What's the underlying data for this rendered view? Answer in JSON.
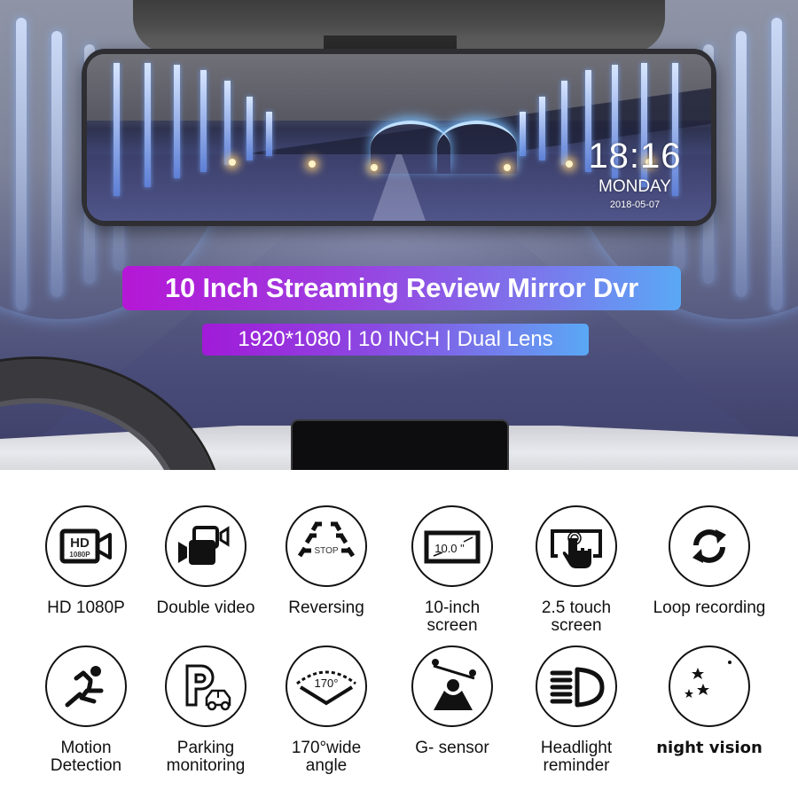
{
  "hero": {
    "mirror_display": {
      "time": "18:16",
      "day": "MONDAY",
      "date": "2018-05-07"
    },
    "title": "10 Inch Streaming Review Mirror Dvr",
    "subtitle": "1920*1080 | 10 INCH | Dual Lens",
    "colors": {
      "badge_gradient_start": "#b517d6",
      "badge_gradient_end": "#5aa8f5"
    }
  },
  "features": [
    {
      "icon": "hd-camera-icon",
      "label": "HD 1080P",
      "icon_text": [
        "HD",
        "1080P"
      ]
    },
    {
      "icon": "double-video-icon",
      "label": "Double video"
    },
    {
      "icon": "reversing-guide-icon",
      "label": "Reversing",
      "icon_text": [
        "STOP"
      ]
    },
    {
      "icon": "screen-size-icon",
      "label": "10-inch\nscreen",
      "icon_text": [
        "10.0 \""
      ]
    },
    {
      "icon": "touch-screen-icon",
      "label": "2.5 touch\nscreen"
    },
    {
      "icon": "loop-icon",
      "label": "Loop recording"
    },
    {
      "icon": "running-person-icon",
      "label": "Motion\nDetection"
    },
    {
      "icon": "parking-car-icon",
      "label": "Parking\nmonitoring"
    },
    {
      "icon": "wide-angle-icon",
      "label": "170°wide\nangle",
      "icon_text": [
        "170°"
      ]
    },
    {
      "icon": "g-sensor-icon",
      "label": "G- sensor"
    },
    {
      "icon": "headlight-icon",
      "label": "Headlight\nreminder"
    },
    {
      "icon": "moon-stars-icon",
      "label": "night vision"
    }
  ]
}
